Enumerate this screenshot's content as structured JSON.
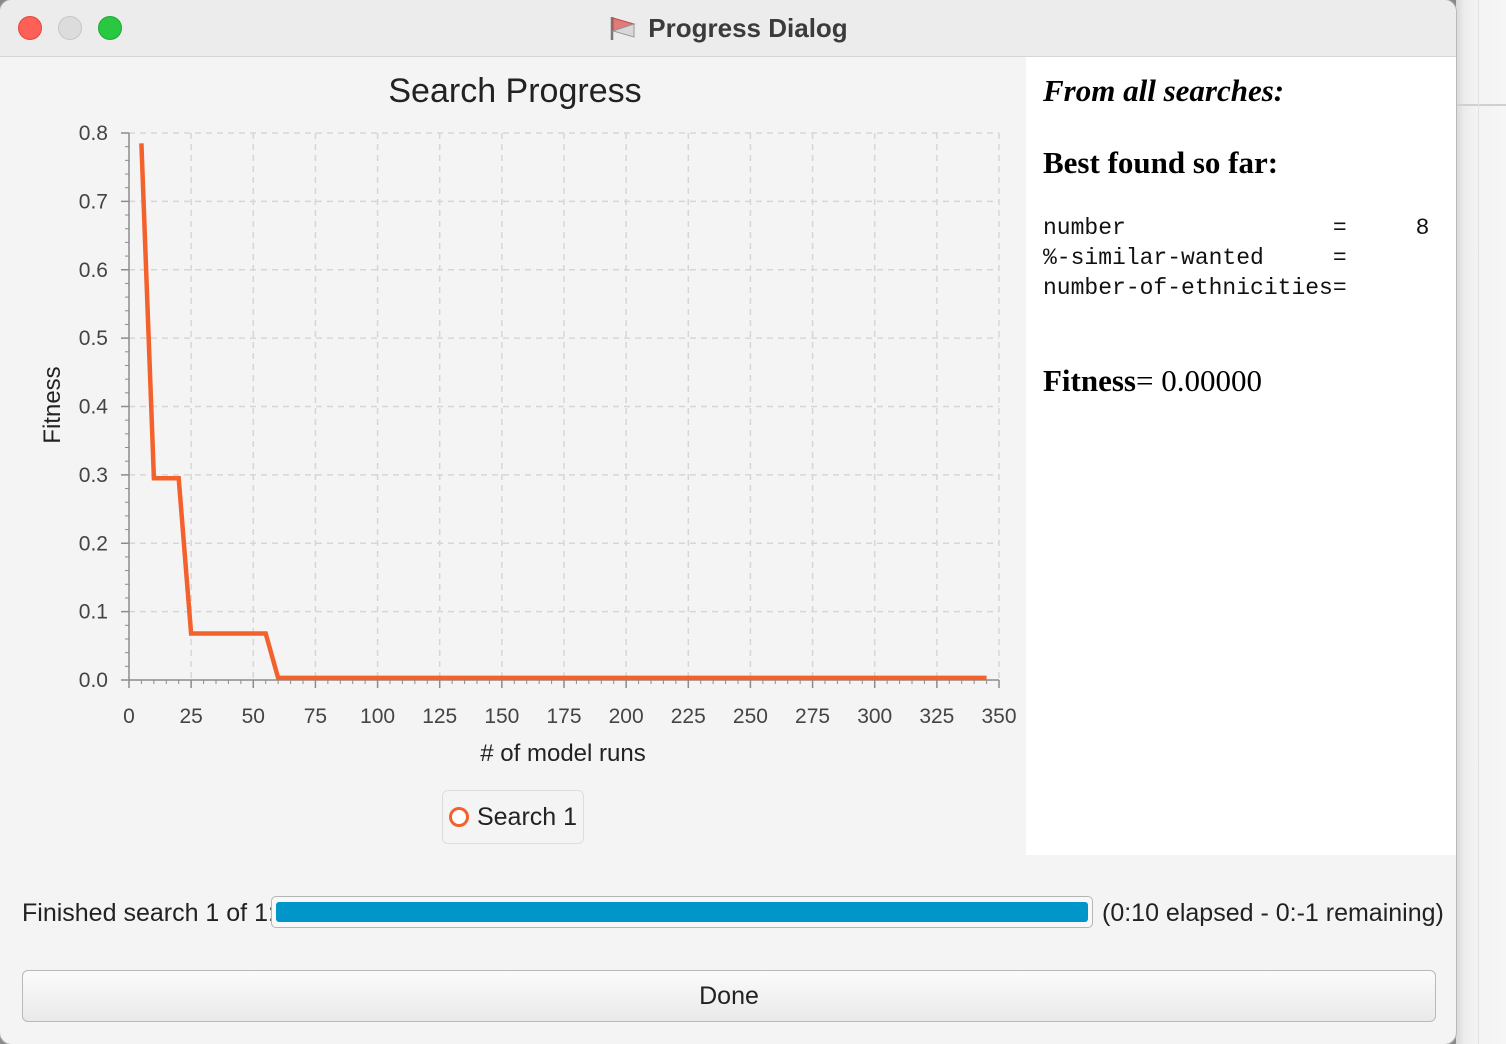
{
  "window": {
    "title": "Progress Dialog"
  },
  "chart_data": {
    "type": "line",
    "title": "Search Progress",
    "xlabel": "# of model runs",
    "ylabel": "Fitness",
    "xlim": [
      0,
      350
    ],
    "ylim": [
      0,
      0.8
    ],
    "x_ticks": [
      0,
      25,
      50,
      75,
      100,
      125,
      150,
      175,
      200,
      225,
      250,
      275,
      300,
      325,
      350
    ],
    "y_ticks": [
      0.0,
      0.1,
      0.2,
      0.3,
      0.4,
      0.5,
      0.6,
      0.7,
      0.8
    ],
    "y_tick_labels": [
      "0.0",
      "0.1",
      "0.2",
      "0.3",
      "0.4",
      "0.5",
      "0.6",
      "0.7",
      "0.8"
    ],
    "grid": true,
    "legend_position": "bottom",
    "series": [
      {
        "name": "Search 1",
        "color": "#f3622d",
        "x": [
          5,
          10,
          20,
          25,
          55,
          60,
          345
        ],
        "y": [
          0.785,
          0.295,
          0.295,
          0.068,
          0.068,
          0.003,
          0.003
        ]
      }
    ]
  },
  "info": {
    "heading": "From all searches:",
    "best_heading": "Best found so far:",
    "params": [
      {
        "name": "number",
        "sep": "=",
        "value": "8"
      },
      {
        "name": "%-similar-wanted",
        "sep": "=",
        "value": ""
      },
      {
        "name": "number-of-ethnicities",
        "sep": "=",
        "value": ""
      }
    ],
    "fitness_label": "Fitness",
    "fitness_value": "= 0.00000"
  },
  "status": {
    "label": "Finished search 1 of 1:",
    "progress": 1.0,
    "time_text": "(0:10 elapsed - 0:-1 remaining)",
    "progress_color": "#0096c9"
  },
  "done_label": "Done"
}
